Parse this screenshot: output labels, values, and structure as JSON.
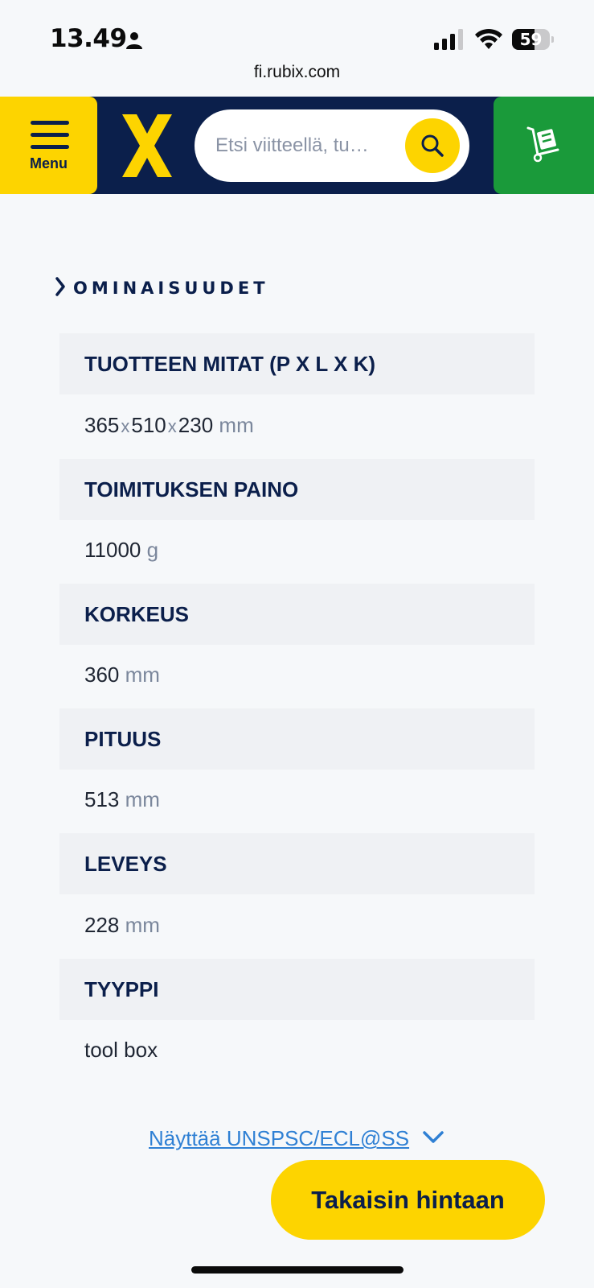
{
  "status_bar": {
    "time": "13.49",
    "battery_level": "59",
    "battery_fraction": 0.59
  },
  "browser": {
    "url": "fi.rubix.com"
  },
  "header": {
    "menu_label": "Menu",
    "search_placeholder": "Etsi viitteellä, tu…",
    "brand_color": "#0b1f4b",
    "accent_color": "#fdd400",
    "cart_color": "#1a9a3a"
  },
  "section": {
    "title": "OMINAISUUDET"
  },
  "specs": [
    {
      "label": "TUOTTEEN MITAT (P X L X K)",
      "value_parts": [
        "365",
        "x",
        "510",
        "x",
        "230"
      ],
      "unit": "mm"
    },
    {
      "label": "TOIMITUKSEN PAINO",
      "value": "11000",
      "unit": "g"
    },
    {
      "label": "KORKEUS",
      "value": "360",
      "unit": "mm"
    },
    {
      "label": "PITUUS",
      "value": "513",
      "unit": "mm"
    },
    {
      "label": "LEVEYS",
      "value": "228",
      "unit": "mm"
    },
    {
      "label": "TYYPPI",
      "value": "tool box",
      "unit": ""
    }
  ],
  "links": {
    "unspsc": "Näyttää UNSPSC/ECL@SS"
  },
  "actions": {
    "back_to_price": "Takaisin hintaan"
  }
}
